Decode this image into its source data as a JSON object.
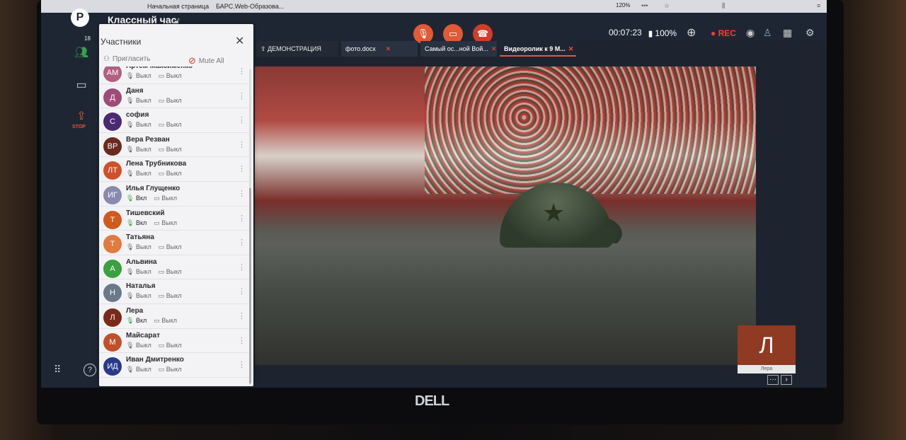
{
  "browser": {
    "tabs": [
      "Начальная страница",
      "БАРС.Web-Образова..."
    ],
    "zoom": "120%"
  },
  "app": {
    "room_title": "Классный час",
    "timer": "00:07:23",
    "signal": "100%",
    "rec": "REC",
    "participants_count": "18",
    "stop_label": "STOP"
  },
  "panel": {
    "title": "Участники",
    "invite": "Пригласить",
    "mute_all": "Mute All",
    "participants": [
      {
        "initials": "АМ",
        "name": "Артем Максименко",
        "mic": "Выкл",
        "cam": "Выкл",
        "color": "#b06080"
      },
      {
        "initials": "Д",
        "name": "Даня",
        "mic": "Выкл",
        "cam": "Выкл",
        "color": "#a04a7a"
      },
      {
        "initials": "С",
        "name": "софия",
        "mic": "Выкл",
        "cam": "Выкл",
        "color": "#4a2a70"
      },
      {
        "initials": "ВР",
        "name": "Вера Резван",
        "mic": "Выкл",
        "cam": "Выкл",
        "color": "#6a2a1e"
      },
      {
        "initials": "ЛТ",
        "name": "Лена Трубникова",
        "mic": "Выкл",
        "cam": "Выкл",
        "color": "#d0502a"
      },
      {
        "initials": "ИГ",
        "name": "Илья Глущенко",
        "mic": "Вкл",
        "cam": "Выкл",
        "color": "#8a8ab0"
      },
      {
        "initials": "Т",
        "name": "Тишевский",
        "mic": "Вкл",
        "cam": "Выкл",
        "color": "#d05a1e"
      },
      {
        "initials": "Т",
        "name": "Татьяна",
        "mic": "Выкл",
        "cam": "Выкл",
        "color": "#e07a40"
      },
      {
        "initials": "А",
        "name": "Альвина",
        "mic": "Выкл",
        "cam": "Выкл",
        "color": "#3aa040"
      },
      {
        "initials": "Н",
        "name": "Наталья",
        "mic": "Выкл",
        "cam": "Выкл",
        "color": "#6a7a8a"
      },
      {
        "initials": "Л",
        "name": "Лера",
        "mic": "Вкл",
        "cam": "Выкл",
        "color": "#7a2a1a"
      },
      {
        "initials": "М",
        "name": "Майсарат",
        "mic": "Выкл",
        "cam": "Выкл",
        "color": "#c0502a"
      },
      {
        "initials": "ИД",
        "name": "Иван Дмитренко",
        "mic": "Выкл",
        "cam": "Выкл",
        "color": "#2a3a8a"
      }
    ]
  },
  "doc_tabs": {
    "demo": "ДЕМОНСТРАЦИЯ",
    "tab1": "фото.docx",
    "tab2": "Самый ос...ной Вой...",
    "tab3": "Видеоролик к 9 М..."
  },
  "speaker_tile": {
    "initial": "Л",
    "name": "Лера"
  },
  "bezel": {
    "brand": "DELL"
  },
  "colors": {
    "accent": "#e05a36",
    "rec": "#ff3b30",
    "mic_on": "#3aa04a"
  }
}
